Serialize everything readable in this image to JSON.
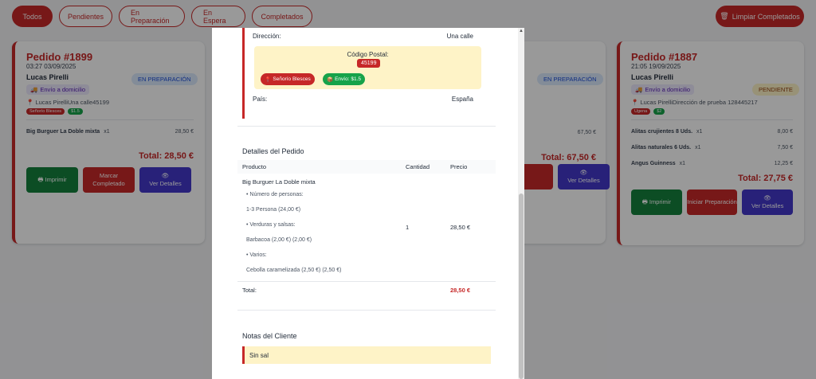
{
  "filters": [
    {
      "label": "Todos",
      "active": true
    },
    {
      "label": "Pendientes",
      "active": false
    },
    {
      "label": "En Preparación",
      "active": false
    },
    {
      "label": "En Espera",
      "active": false
    },
    {
      "label": "Completados",
      "active": false
    }
  ],
  "clear_button": {
    "label": "Limpiar Completados"
  },
  "cards": {
    "c1899": {
      "title": "Pedido #1899",
      "date": "03:27 03/09/2025",
      "customer": "Lucas Pirelli",
      "status": "EN PREPARACIÓN",
      "delivery": "Envío a domicilio",
      "address": "Lucas PirelliUna calle45199",
      "tag1": "Señorío Blesces",
      "tag2": "$1.5",
      "item_name": "Big Burguer La Doble mixta",
      "item_qty": "x1",
      "item_price": "28,50 €",
      "total": "Total: 28,50 €",
      "btn_print": "Imprimir",
      "btn_mark": "Marcar Completado",
      "btn_details": "Ver Detalles"
    },
    "c_mid": {
      "status": "EN PREPARACIÓN",
      "item_price": "67,50 €",
      "total": "Total: 67,50 €",
      "btn_details": "Ver Detalles"
    },
    "c1887": {
      "title": "Pedido #1887",
      "date": "21:05 19/09/2025",
      "customer": "Lucas Pirelli",
      "status": "PENDIENTE",
      "delivery": "Envío a domicilio",
      "address": "Lucas PirelliDirección de prueba 128445217",
      "tag1": "Ugena",
      "tag2": "$2",
      "items": [
        {
          "name": "Alitas crujientes 8 Uds.",
          "qty": "x1",
          "price": "8,00 €"
        },
        {
          "name": "Alitas naturales 6 Uds.",
          "qty": "x1",
          "price": "7,50 €"
        },
        {
          "name": "Angus Guinness",
          "qty": "x1",
          "price": "12,25 €"
        }
      ],
      "total": "Total: 27,75 €",
      "btn_print": "Imprimir",
      "btn_start": "Iniciar Preparación",
      "btn_details": "Ver Detalles"
    }
  },
  "modal": {
    "address_label": "Dirección:",
    "address_value": "Una calle",
    "postal_label": "Código Postal:",
    "postal_value": "45199",
    "zone_chip": "Señorío Blesces",
    "shipping_chip": "Envío: $1.5",
    "country_label": "País:",
    "country_value": "España",
    "details_heading": "Detalles del Pedido",
    "col_product": "Producto",
    "col_qty": "Cantidad",
    "col_price": "Precio",
    "product_name": "Big Burguer La Doble mixta",
    "options": [
      {
        "text": "• Número de personas:",
        "indent": true
      },
      {
        "text": "1-3 Persona (24,00 €)",
        "indent": false
      },
      {
        "text": "• Verduras y salsas:",
        "indent": true
      },
      {
        "text": "Barbacoa (2,00 €) (2,00 €)",
        "indent": false
      },
      {
        "text": "• Varios:",
        "indent": true
      },
      {
        "text": "Cebolla caramelizada (2,50 €) (2,50 €)",
        "indent": false
      }
    ],
    "product_qty": "1",
    "product_price": "28,50 €",
    "total_label": "Total:",
    "total_value": "28,50 €",
    "notes_heading": "Notas del Cliente",
    "notes_text": "Sin sal"
  }
}
